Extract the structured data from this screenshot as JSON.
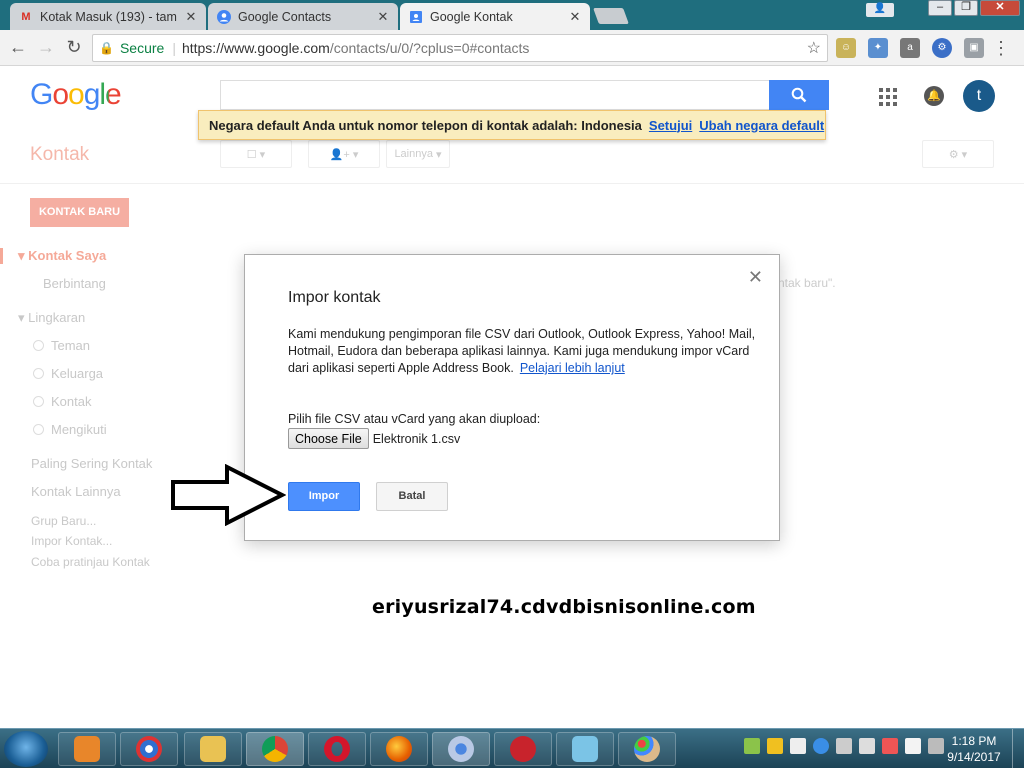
{
  "browser": {
    "tabs": [
      {
        "title": "Kotak Masuk (193) - tam",
        "favicon": "gmail-icon"
      },
      {
        "title": "Google Contacts",
        "favicon": "contacts-icon"
      },
      {
        "title": "Google Kontak",
        "favicon": "contacts-book-icon",
        "active": true
      }
    ],
    "address": {
      "secure_label": "Secure",
      "url_main": "https://www.google.com",
      "url_rest": "/contacts/u/0/?cplus=0#contacts"
    }
  },
  "google": {
    "logo": "Google",
    "avatar_letter": "t",
    "notice": {
      "text": "Negara default Anda untuk nomor telepon di kontak adalah: Indonesia",
      "agree": "Setujui",
      "change": "Ubah negara default"
    }
  },
  "app": {
    "title": "Kontak",
    "more_label": "Lainnya",
    "new_contact": "KONTAK BARU",
    "sidebar": {
      "my_contacts": "Kontak Saya",
      "starred": "Berbintang",
      "circles": "Lingkaran",
      "circle_items": [
        "Teman",
        "Keluarga",
        "Kontak",
        "Mengikuti"
      ],
      "most_contacted": "Paling Sering Kontak",
      "other_contacts": "Kontak Lainnya",
      "new_group": "Grup Baru...",
      "import": "Impor Kontak...",
      "preview": "Coba pratinjau Kontak"
    },
    "bg_fragment": "ntak baru\"."
  },
  "dialog": {
    "title": "Impor kontak",
    "body": "Kami mendukung pengimporan file CSV dari Outlook, Outlook Express, Yahoo! Mail, Hotmail, Eudora dan beberapa aplikasi lainnya. Kami juga mendukung impor vCard dari aplikasi seperti Apple Address Book.",
    "learn_more": "Pelajari lebih lanjut",
    "file_label": "Pilih file CSV atau vCard yang akan diupload:",
    "choose_file": "Choose File",
    "file_name": "Elektronik 1.csv",
    "import_button": "Impor",
    "cancel_button": "Batal"
  },
  "watermark": "eriyusrizal74.cdvdbisnisonline.com",
  "taskbar": {
    "time": "1:18 PM",
    "date": "9/14/2017"
  },
  "colors": {
    "accent_blue": "#4d90fe",
    "google_red": "#dd4b39",
    "notice_bg": "#f9edbe"
  }
}
